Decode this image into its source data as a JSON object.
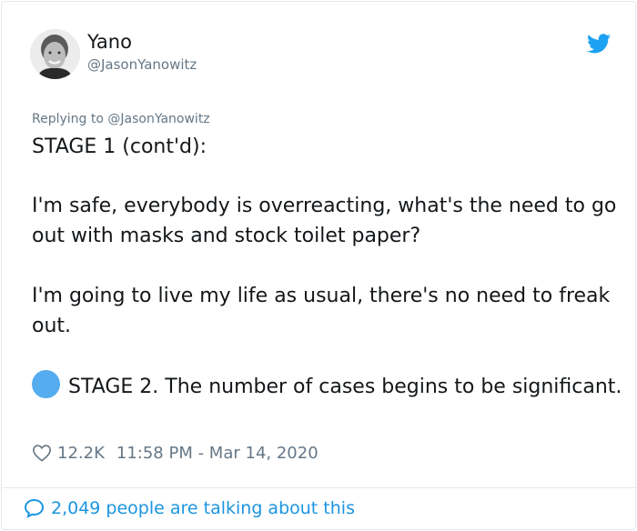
{
  "tweet": {
    "display_name": "Yano",
    "handle": "@JasonYanowitz",
    "replying_prefix": "Replying to ",
    "replying_to": "@JasonYanowitz",
    "stage1": "STAGE 1 (cont'd):",
    "para1": "I'm safe, everybody is overreacting, what's the need to go out with masks and stock toilet paper?",
    "para2": "I'm going to live my life as usual, there's no need to freak out.",
    "para3": "STAGE 2. The number of cases begins to be significant.",
    "likes": "12.2K",
    "timestamp": "11:58 PM - Mar 14, 2020"
  },
  "footer": {
    "talking": "2,049 people are talking about this"
  },
  "icons": {
    "brand": "twitter-bird-icon",
    "like": "heart-outline-icon",
    "reply": "speech-bubble-icon",
    "bullet": "blue-circle-emoji"
  },
  "colors": {
    "twitter_blue": "#1da1f2",
    "link_blue": "#1b95e0",
    "dot_blue": "#55acee",
    "muted": "#657786",
    "text": "#14171a"
  }
}
